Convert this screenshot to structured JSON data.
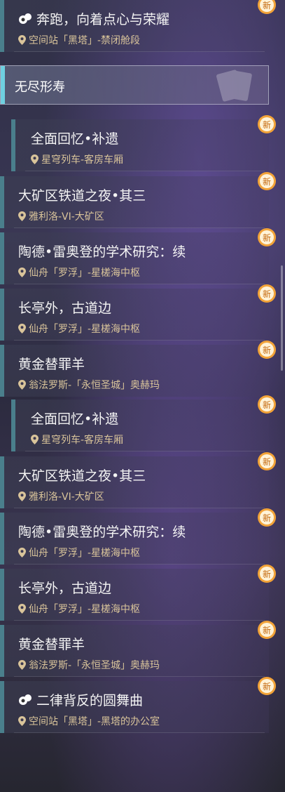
{
  "category": {
    "label": "无尽形寿"
  },
  "badge_text": "新",
  "items": [
    {
      "title": "奔跑，向着点心与荣耀",
      "location": "空间站「黑塔」-禁闭舱段",
      "has_quest_icon": true
    },
    {
      "title": "全面回忆•补遗",
      "location": "星穹列车-客房车厢"
    },
    {
      "title": "大矿区铁道之夜•其三",
      "location": "雅利洛-VI-大矿区"
    },
    {
      "title": "陶德•雷奥登的学术研究：续",
      "location": "仙舟「罗浮」-星槎海中枢"
    },
    {
      "title": "长亭外，古道边",
      "location": "仙舟「罗浮」-星槎海中枢"
    },
    {
      "title": "黄金替罪羊",
      "location": "翁法罗斯-「永恒圣城」奥赫玛"
    },
    {
      "title": "全面回忆•补遗",
      "location": "星穹列车-客房车厢"
    },
    {
      "title": "大矿区铁道之夜•其三",
      "location": "雅利洛-VI-大矿区"
    },
    {
      "title": "陶德•雷奥登的学术研究：续",
      "location": "仙舟「罗浮」-星槎海中枢"
    },
    {
      "title": "长亭外，古道边",
      "location": "仙舟「罗浮」-星槎海中枢"
    },
    {
      "title": "黄金替罪羊",
      "location": "翁法罗斯-「永恒圣城」奥赫玛"
    },
    {
      "title": "二律背反的圆舞曲",
      "location": "空间站「黑塔」-黑塔的办公室",
      "has_quest_icon": true
    }
  ]
}
